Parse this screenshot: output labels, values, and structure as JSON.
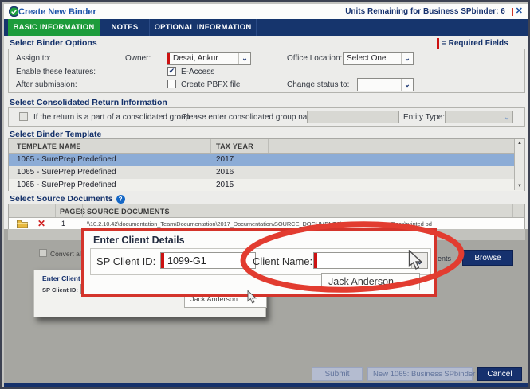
{
  "window": {
    "title": "Create New Binder",
    "units_label": "Units Remaining for Business SPbinder: 6"
  },
  "tabs": [
    {
      "label": "BASIC INFORMATION",
      "active": true
    },
    {
      "label": "NOTES",
      "active": false
    },
    {
      "label": "OPTIONAL INFORMATION",
      "active": false
    }
  ],
  "legend": {
    "required": "= Required Fields"
  },
  "binder_options": {
    "heading": "Select Binder Options",
    "assign_to_label": "Assign to:",
    "owner_label": "Owner:",
    "owner_value": "Desai, Ankur",
    "office_label": "Office Location:",
    "office_value": "Select One",
    "features_label": "Enable these features:",
    "eaccess_label": "E-Access",
    "after_label": "After submission:",
    "pbfx_label": "Create PBFX file",
    "status_label": "Change status to:",
    "status_value": ""
  },
  "consolidated": {
    "heading": "Select Consolidated Return Information",
    "checkbox_label": "If the return is a part of a consolidated group.",
    "group_name_label": "Please enter consolidated group name:",
    "group_name_value": "",
    "entity_label": "Entity Type:",
    "entity_value": ""
  },
  "template": {
    "heading": "Select Binder Template",
    "columns": [
      "TEMPLATE NAME",
      "TAX YEAR"
    ],
    "rows": [
      {
        "name": "1065 - SurePrep Predefined",
        "year": "2017",
        "selected": true
      },
      {
        "name": "1065 - SurePrep Predefined",
        "year": "2016",
        "selected": false
      },
      {
        "name": "1065 - SurePrep Predefined",
        "year": "2015",
        "selected": false
      }
    ]
  },
  "source_docs": {
    "heading": "Select Source Documents",
    "columns": [
      "PAGES",
      "SOURCE DOCUMENTS"
    ],
    "rows": [
      {
        "pages": "1",
        "path": "\\\\10.2.10.42\\documentation_Team\\Documentation\\2017_Documentation\\SOURCE_DOCUMENTS\\DemoDoc\\Source_Docs\\printed pd"
      }
    ],
    "convert_fragment": "Convert al",
    "right_fragment": "ents",
    "browse_label": "Browse"
  },
  "client_dialog": {
    "title": "Enter Client Details",
    "sp_client_id_label": "SP Client ID:",
    "sp_client_id_value": "1099-G1",
    "client_name_label": "Client Name:",
    "client_name_value": "",
    "dropdown_option": "Jack Anderson"
  },
  "small_dialog": {
    "title": "Enter Client Details",
    "sp_client_id_label": "SP Client ID:",
    "dropdown_option": "Jack Anderson"
  },
  "footer": {
    "submit": "Submit",
    "binder_type": "New 1065: Business SPbinder",
    "cancel": "Cancel"
  },
  "icons": {
    "close": "✕",
    "help": "?",
    "check": "✔",
    "chevron": "⌄",
    "up": "▲",
    "down": "▼",
    "delete": "✕"
  },
  "colors": {
    "navy": "#16316e",
    "tab_green": "#1d9c3b",
    "required_red": "#cc1111",
    "selection_blue": "#8cacd6",
    "callout_red": "#d4342b",
    "title_blue": "#1a52a8"
  }
}
